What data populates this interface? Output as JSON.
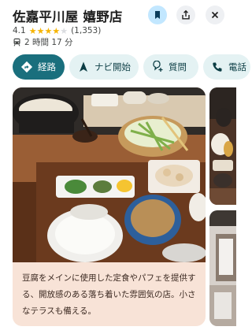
{
  "header": {
    "title": "佐嘉平川屋 嬉野店"
  },
  "rating": {
    "value": "4.1",
    "stars": 4.1,
    "reviews": "(1,353)"
  },
  "transit": {
    "icon": "train-icon",
    "duration": "2 時間 17 分"
  },
  "actions": [
    {
      "label": "経路",
      "icon": "directions-icon"
    },
    {
      "label": "ナビ開始",
      "icon": "navigation-arrow-icon"
    },
    {
      "label": "質問",
      "icon": "ask-question-icon"
    },
    {
      "label": "電話",
      "icon": "phone-icon"
    }
  ],
  "description": "豆腐をメインに使用した定食やパフェを提供する、開放感のある落ち着いた雰囲気の店。小さなテラスも備える。",
  "colors": {
    "primary": "#1a6f7d",
    "chip_bg": "#e4f2f3",
    "caption_bg": "#f8e3d7",
    "star": "#f6b400"
  }
}
